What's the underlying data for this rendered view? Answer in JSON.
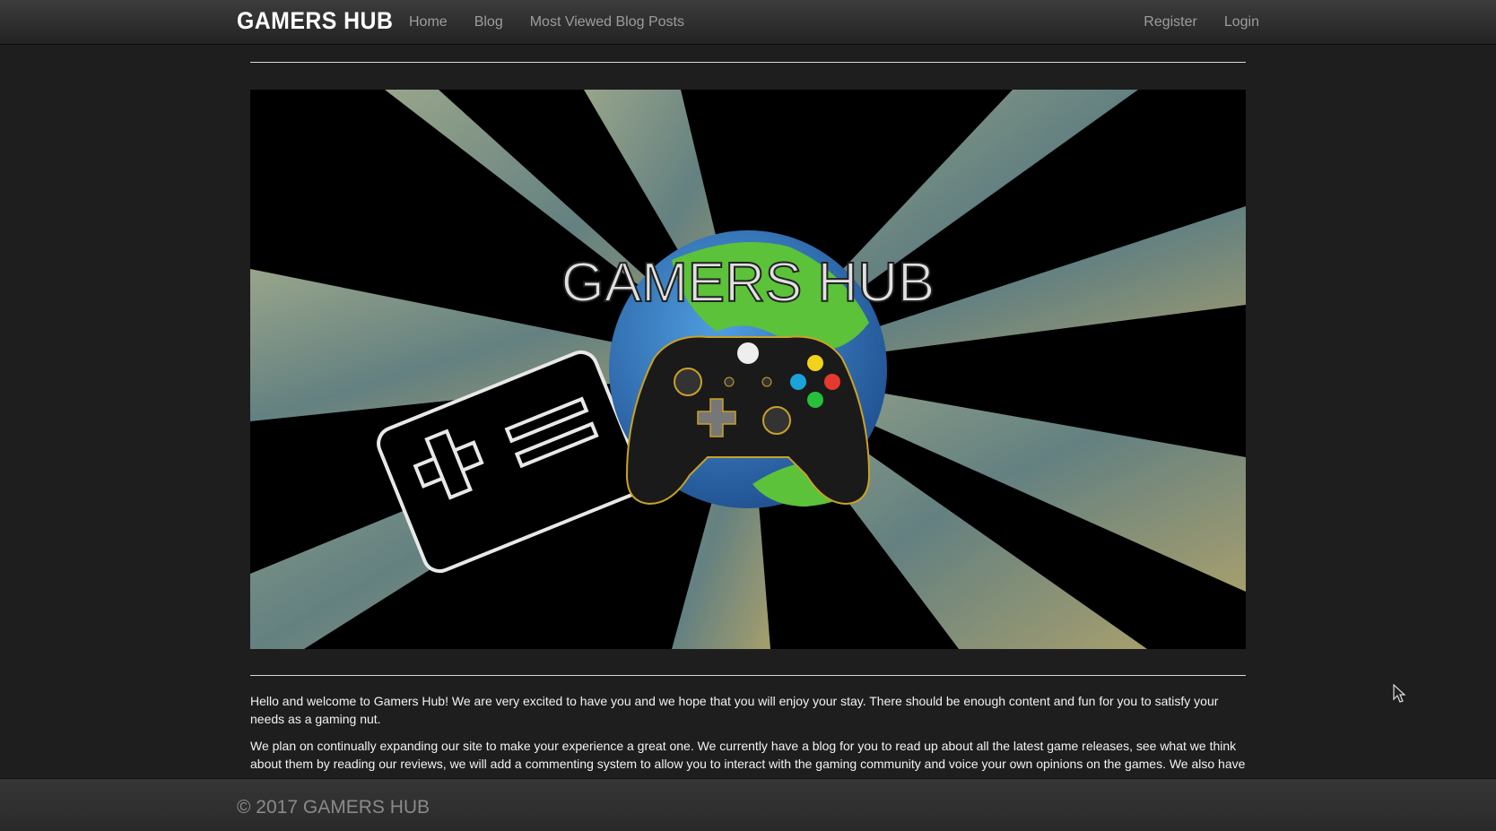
{
  "navbar": {
    "brand": "GAMERS HUB",
    "left_links": [
      "Home",
      "Blog",
      "Most Viewed Blog Posts"
    ],
    "right_links": [
      "Register",
      "Login"
    ]
  },
  "hero": {
    "logo_text": "GAMERS HUB"
  },
  "content": {
    "paragraphs": [
      "Hello and welcome to Gamers Hub! We are very excited to have you and we hope that you will enjoy your stay. There should be enough content and fun for you to satisfy your needs as a gaming nut.",
      "We plan on continually expanding our site to make your experience a great one. We currently have a blog for you to read up about all the latest game releases, see what we think about them by reading our reviews, we will add a commenting system to allow you to interact with the gaming community and voice your own opinions on the games. We also have"
    ]
  },
  "footer": {
    "text": "© 2017 GAMERS HUB"
  },
  "colors": {
    "navbar_bg": "#2b2b2b",
    "page_bg": "#1e1e1e",
    "link": "#9d9d9d",
    "controller_gold": "#c9a227"
  }
}
